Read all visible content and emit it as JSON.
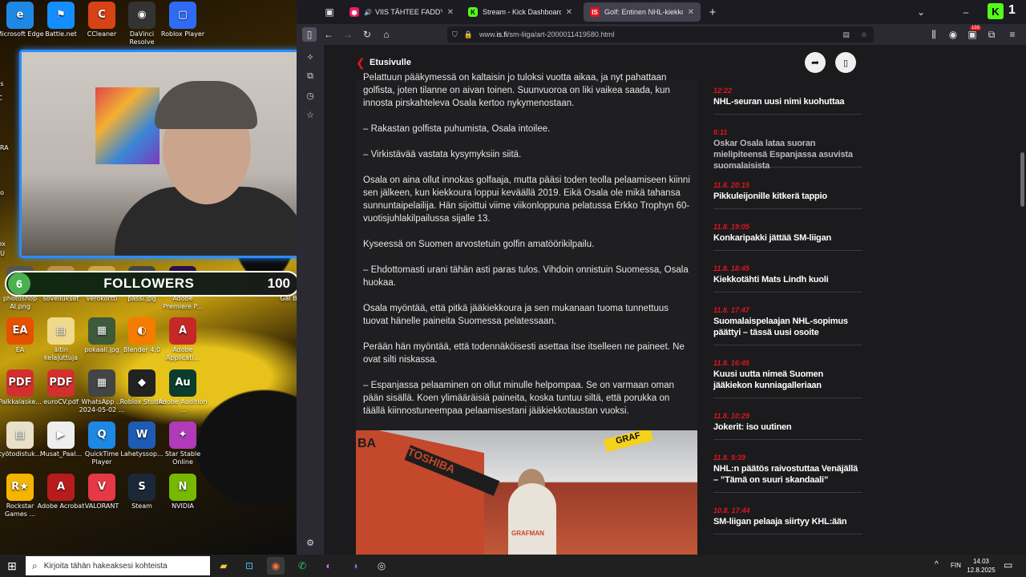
{
  "desktop": {
    "icons_row1": [
      {
        "label": "Microsoft Edge",
        "glyph": "e",
        "color": "#1e88e5"
      },
      {
        "label": "Battle.net",
        "glyph": "⚑",
        "color": "#148eff"
      },
      {
        "label": "CCleaner",
        "glyph": "C",
        "color": "#d84315"
      },
      {
        "label": "DaVinci Resolve",
        "glyph": "◉",
        "color": "#333"
      },
      {
        "label": "Roblox Player",
        "glyph": "▢",
        "color": "#2f6cf6"
      }
    ],
    "left_strip": [
      "Es",
      "C",
      "VARA",
      "Ro",
      "Lex",
      "HU"
    ],
    "icons_row2": [
      {
        "label": "photoshop AI.png",
        "glyph": "▦",
        "color": "#555"
      },
      {
        "label": "sovellukset",
        "glyph": "▤",
        "color": "#b69249"
      },
      {
        "label": "verokortti",
        "glyph": "▤",
        "color": "#c8a64a"
      },
      {
        "label": "passi.jpg",
        "glyph": "▦",
        "color": "#444"
      },
      {
        "label": "Adobe Premiere P...",
        "glyph": "Pr",
        "color": "#2b0f4a"
      }
    ],
    "right_edge_label": "Gal B",
    "icons_row3": [
      {
        "label": "EA",
        "glyph": "EA",
        "color": "#e65100"
      },
      {
        "label": "äitin kelajuttuja",
        "glyph": "▤",
        "color": "#f0d98a"
      },
      {
        "label": "pokaali.jpg",
        "glyph": "▦",
        "color": "#3d5a3a"
      },
      {
        "label": "Blender 4.0",
        "glyph": "◐",
        "color": "#f57c00"
      },
      {
        "label": "Adobe Applicati...",
        "glyph": "A",
        "color": "#c62828"
      }
    ],
    "icons_row4": [
      {
        "label": "Palkkalaske...",
        "glyph": "PDF",
        "color": "#d32f2f"
      },
      {
        "label": "euroCV.pdf",
        "glyph": "PDF",
        "color": "#d32f2f"
      },
      {
        "label": "WhatsApp ... 2024-05-02 ...",
        "glyph": "▦",
        "color": "#444"
      },
      {
        "label": "Roblox Studio",
        "glyph": "◆",
        "color": "#222"
      },
      {
        "label": "Adobe Audition ...",
        "glyph": "Au",
        "color": "#0a3d2e"
      }
    ],
    "icons_row5": [
      {
        "label": "työtodistuk...",
        "glyph": "▤",
        "color": "#e8e0c8"
      },
      {
        "label": "Musat_Paal...",
        "glyph": "▶",
        "color": "#eee"
      },
      {
        "label": "QuickTime Player",
        "glyph": "Q",
        "color": "#1e88e5"
      },
      {
        "label": "Lahetyssop...",
        "glyph": "W",
        "color": "#1e5bb5"
      },
      {
        "label": "Star Stable Online",
        "glyph": "✦",
        "color": "#b03ab8"
      }
    ],
    "icons_row6": [
      {
        "label": "Rockstar Games ...",
        "glyph": "R★",
        "color": "#f4b400"
      },
      {
        "label": "Adobe Acrobat",
        "glyph": "A",
        "color": "#b71c1c"
      },
      {
        "label": "VALORANT",
        "glyph": "V",
        "color": "#e53945"
      },
      {
        "label": "Steam",
        "glyph": "S",
        "color": "#1b2838"
      },
      {
        "label": "NVIDIA",
        "glyph": "N",
        "color": "#76b900"
      }
    ]
  },
  "followers_widget": {
    "current": "6",
    "label": "FOLLOWERS",
    "goal": "100"
  },
  "browser": {
    "tabs": [
      {
        "title": "VIIS TÄHTEE FADDY PUFFER",
        "icon_color": "#e91e63",
        "icon_glyph": "◉",
        "active": false
      },
      {
        "title": "Stream - Kick Dashboard",
        "icon_color": "#53fc18",
        "icon_glyph": "K",
        "active": false
      },
      {
        "title": "Golf: Entinen NHL-kiekkoilija Os",
        "icon_color": "#e2151b",
        "icon_glyph": "IS",
        "active": true
      }
    ],
    "new_tab_label": "+",
    "url_prefix": "www.",
    "url_domain": "is.fi",
    "url_path": "/sm-liiga/art-2000011419580.html",
    "notifications_badge": "193",
    "kick_badge": "1"
  },
  "page": {
    "back_label": "Etusivulle",
    "paragraphs": [
      "Pelattuun pääkymessä on kaltaisin jo tuloksi vuotta aikaa, ja nyt pahattaan golfista, joten tilanne on aivan toinen. Suunvuoroa on liki vaikea saada, kun innosta pirskahteleva Osala kertoo nykymenostaan.",
      "– Rakastan golfista puhumista, Osala intoilee.",
      "– Virkistävää vastata kysymyksiin siitä.",
      "Osala on aina ollut innokas golfaaja, mutta pääsi toden teolla pelaamiseen kiinni sen jälkeen, kun kiekkoura loppui keväällä 2019. Eikä Osala ole mikä tahansa sunnuntaipelailija. Hän sijoittui viime viikonloppuna pelatussa Erkko Trophyn 60-vuotisjuhlakilpailussa sijalle 13.",
      "Kyseessä on Suomen arvostetuin golfin amatöörikilpailu.",
      "– Ehdottomasti urani tähän asti paras tulos. Vihdoin onnistuin Suomessa, Osala huokaa.",
      "Osala myöntää, että pitkä jääkiekkoura ja sen mukanaan tuoma tunnettuus tuovat hänelle paineita Suomessa pelatessaan.",
      "Perään hän myöntää, että todennäköisesti asettaa itse itselleen ne paineet. Ne ovat silti niskassa.",
      "– Espanjassa pelaaminen on ollut minulle helpompaa. Se on varmaan oman pään sisällä. Koen ylimääräisiä paineita, koska tuntuu siltä, että porukka on täällä kiinnostuneempaa pelaamisestani jääkiekkotaustan vuoksi."
    ],
    "photo_text": {
      "sign1": "TOSHIBA",
      "sign2": "GRAF",
      "jersey": "GRAFMAN",
      "band": "BA"
    },
    "news": [
      {
        "time": "12:22",
        "title": "NHL-seuran uusi nimi kuohuttaa",
        "read": false
      },
      {
        "time": "6:11",
        "title": "Oskar Osala lataa suoran mielipiteensä Espanjassa asuvista suomalaisista",
        "read": true
      },
      {
        "time": "11.8. 20:15",
        "title": "Pikkuleijonille kitkerä tappio",
        "read": false
      },
      {
        "time": "11.8. 19:05",
        "title": "Konkaripakki jättää SM-liigan",
        "read": false
      },
      {
        "time": "11.8. 18:45",
        "title": "Kiekkotähti Mats Lindh kuoli",
        "read": false
      },
      {
        "time": "11.8. 17:47",
        "title": "Suomalaispelaajan NHL-sopimus päättyi – tässä uusi osoite",
        "read": false
      },
      {
        "time": "11.8. 16:45",
        "title": "Kuusi uutta nimeä Suomen jääkiekon kunniagalleriaan",
        "read": false
      },
      {
        "time": "11.8. 10:29",
        "title": "Jokerit: iso uutinen",
        "read": false
      },
      {
        "time": "11.8. 9:39",
        "title": "NHL:n päätös raivostuttaa Venäjällä – ”Tämä on suuri skandaali”",
        "read": false
      },
      {
        "time": "10.8. 17:44",
        "title": "SM-liigan pelaaja siirtyy KHL:ään",
        "read": false
      }
    ]
  },
  "taskbar": {
    "search_placeholder": "Kirjoita tähän hakeaksesi kohteista",
    "language": "FIN",
    "time": "14.03",
    "date": "12.8.2025"
  },
  "colors": {
    "accent_red": "#e2151b",
    "webcam_border": "#2a8cff",
    "follower_green": "#4caf50"
  }
}
